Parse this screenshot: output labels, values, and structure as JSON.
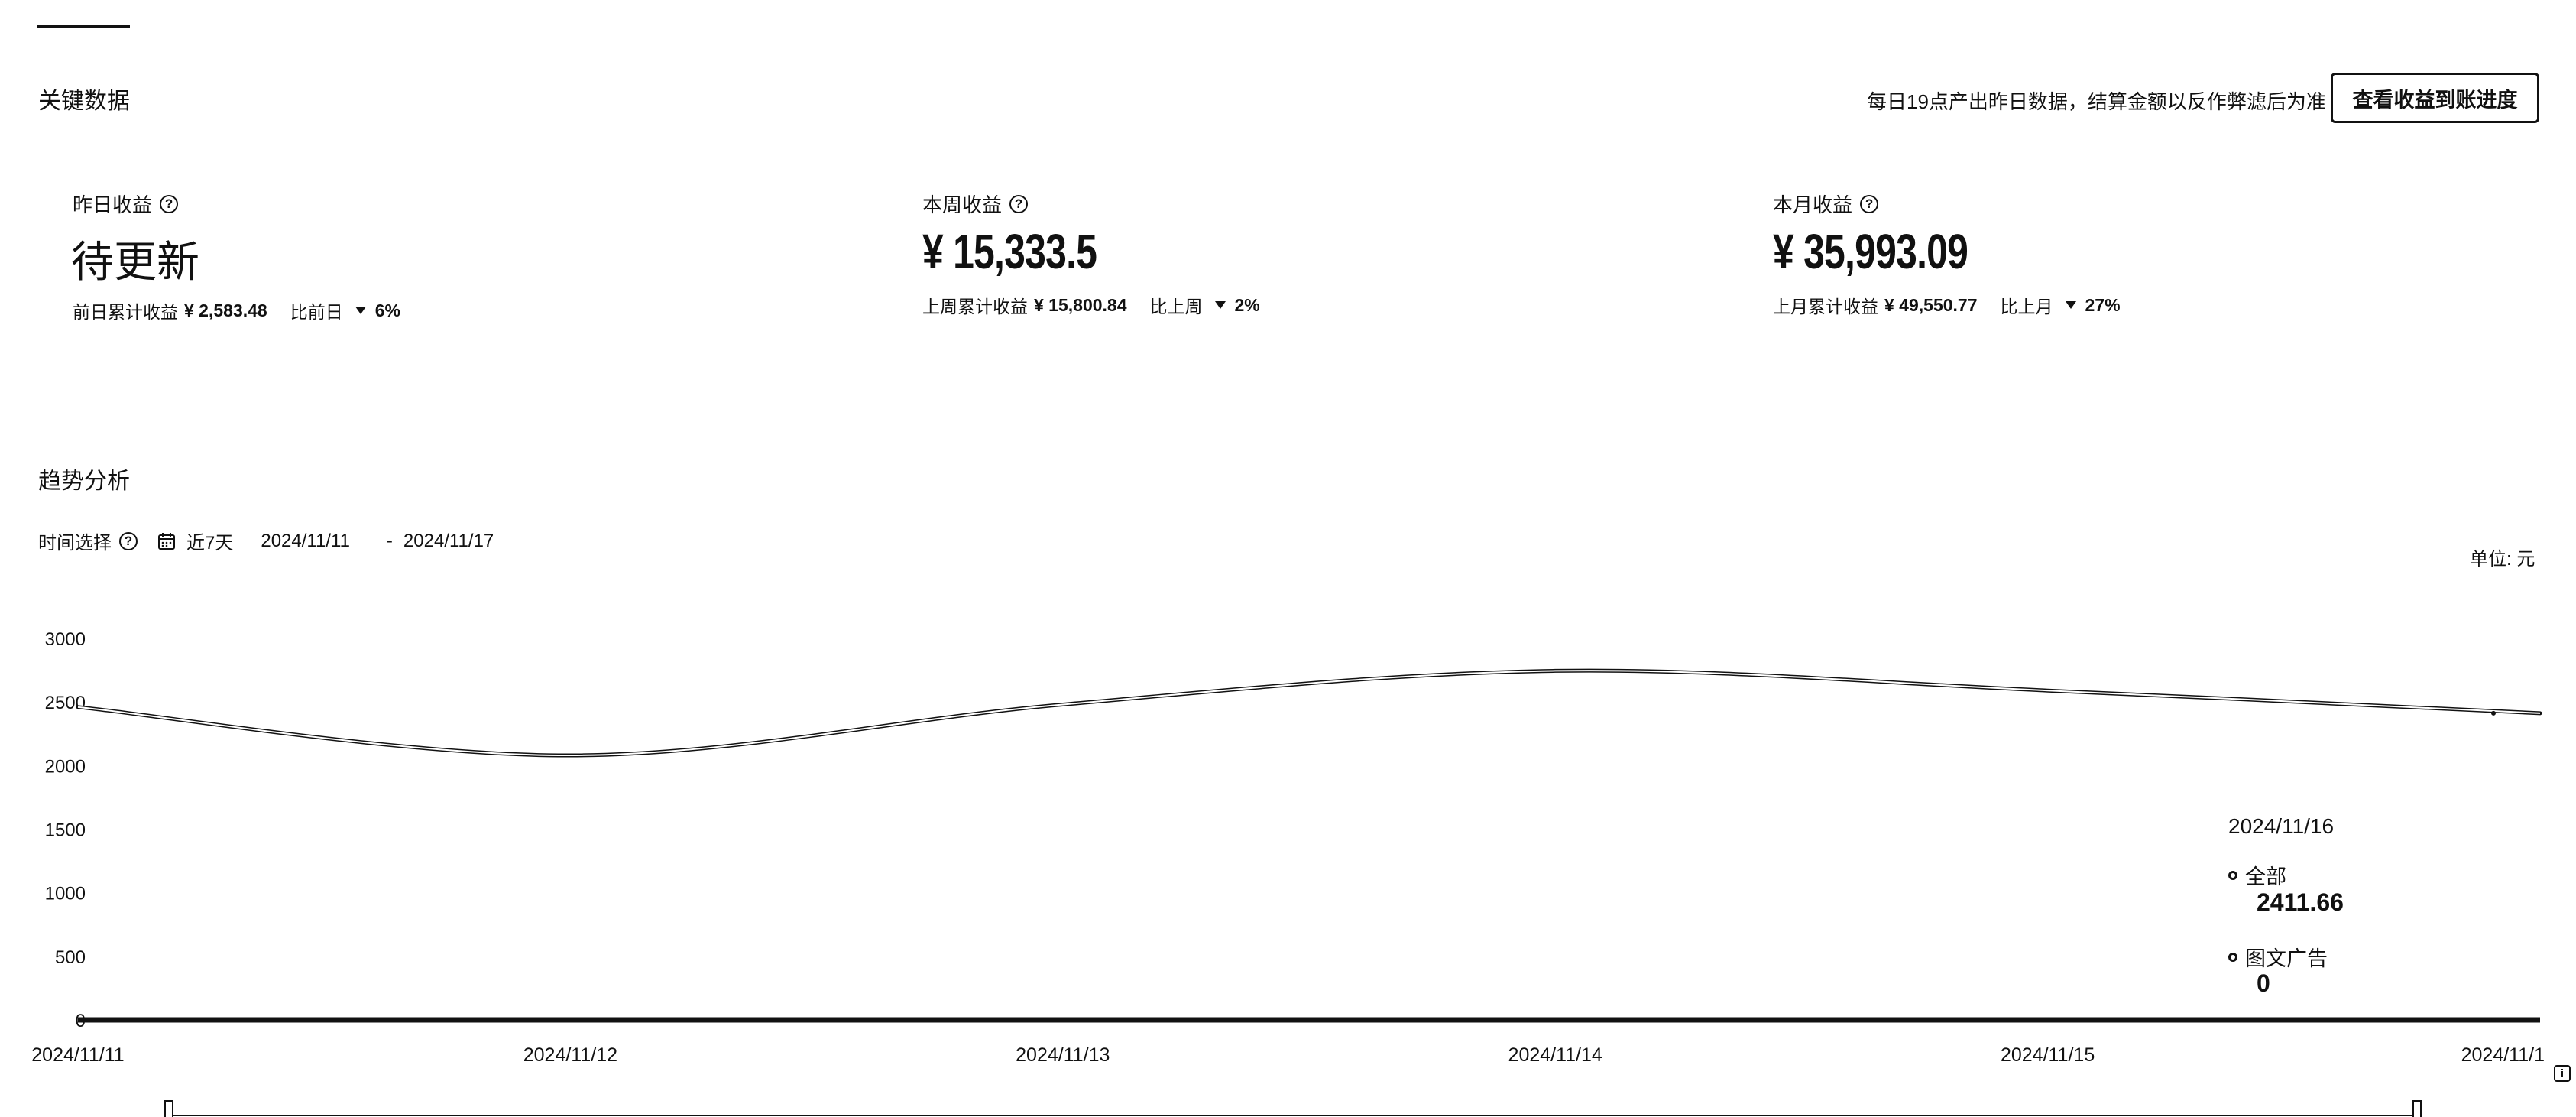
{
  "key_data": {
    "title": "关键数据",
    "notice": "每日19点产出昨日数据，结算金额以反作弊滤后为准",
    "progress_button": "查看收益到账进度",
    "stats": [
      {
        "label": "昨日收益",
        "value": "待更新",
        "sub_label": "前日累计收益",
        "sub_value": "¥ 2,583.48",
        "compare_label": "比前日",
        "compare_value": "6%"
      },
      {
        "label": "本周收益",
        "value": "¥ 15,333.5",
        "sub_label": "上周累计收益",
        "sub_value": "¥ 15,800.84",
        "compare_label": "比上周",
        "compare_value": "2%"
      },
      {
        "label": "本月收益",
        "value": "¥ 35,993.09",
        "sub_label": "上月累计收益",
        "sub_value": "¥ 49,550.77",
        "compare_label": "比上月",
        "compare_value": "27%"
      }
    ]
  },
  "trend": {
    "title": "趋势分析",
    "time_label": "时间选择",
    "range_preset": "近7天",
    "start_date": "2024/11/11",
    "date_separator": "-",
    "end_date": "2024/11/17",
    "unit": "单位:  元",
    "tooltip": {
      "date": "2024/11/16",
      "items": [
        {
          "name": "全部",
          "value": "2411.66"
        },
        {
          "name": "图文广告",
          "value": "0"
        }
      ]
    }
  },
  "chart_data": {
    "type": "line",
    "x": [
      "2024/11/11",
      "2024/11/12",
      "2024/11/13",
      "2024/11/14",
      "2024/11/15",
      "2024/11/16"
    ],
    "x_tick_labels": [
      "2024/11/11",
      "2024/11/12",
      "2024/11/13",
      "2024/11/14",
      "2024/11/15",
      "2024/11/1"
    ],
    "y_ticks": [
      0,
      500,
      1000,
      1500,
      2000,
      2500,
      3000
    ],
    "ylim": [
      0,
      3000
    ],
    "series": [
      {
        "name": "全部",
        "values": [
          2460,
          2080,
          2480,
          2745,
          2590,
          2411.66
        ]
      },
      {
        "name": "图文广告",
        "values": [
          0,
          0,
          0,
          0,
          0,
          0
        ]
      }
    ],
    "ylabel": "单位:  元",
    "grid": false
  }
}
